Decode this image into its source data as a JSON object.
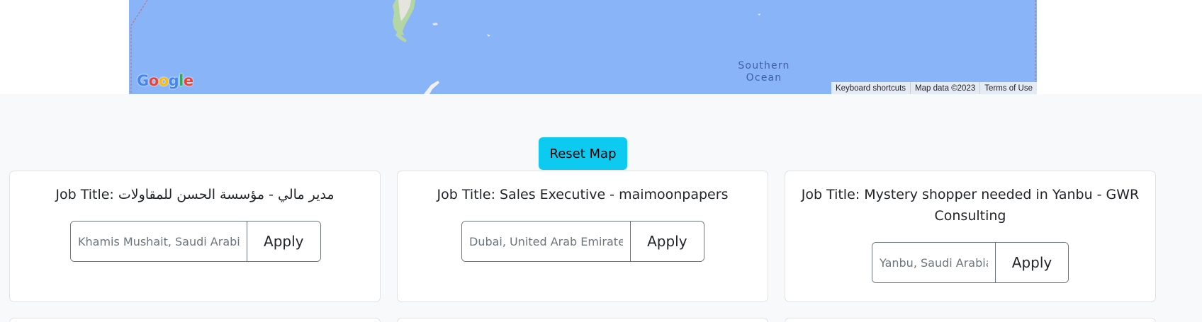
{
  "map": {
    "ocean_label_line1": "Southern",
    "ocean_label_line2": "Ocean",
    "logo_letters": [
      "G",
      "o",
      "o",
      "g",
      "l",
      "e"
    ],
    "logo_colors": [
      "#4285F4",
      "#EA4335",
      "#FBBC05",
      "#4285F4",
      "#34A853",
      "#EA4335"
    ],
    "water_color": "#8ab4f8",
    "zoom_in_icon": "plus-icon",
    "zoom_out_icon": "minus-icon",
    "attribution": {
      "keyboard_shortcuts": "Keyboard shortcuts",
      "map_data": "Map data ©2023",
      "terms": "Terms of Use"
    }
  },
  "reset_button": {
    "label": "Reset Map",
    "color": "#0dcaf0"
  },
  "jobs": [
    {
      "title": "Job Title: مدير مالي - مؤسسة الحسن للمقاولات",
      "location_placeholder": "Khamis Mushait, Saudi Arabia",
      "apply_label": "Apply"
    },
    {
      "title": "Job Title: Sales Executive - maimoonpapers",
      "location_placeholder": "Dubai, United Arab Emirates",
      "apply_label": "Apply"
    },
    {
      "title": "Job Title: Mystery shopper needed in Yanbu - GWR Consulting",
      "location_placeholder": "Yanbu, Saudi Arabia",
      "apply_label": "Apply"
    }
  ]
}
